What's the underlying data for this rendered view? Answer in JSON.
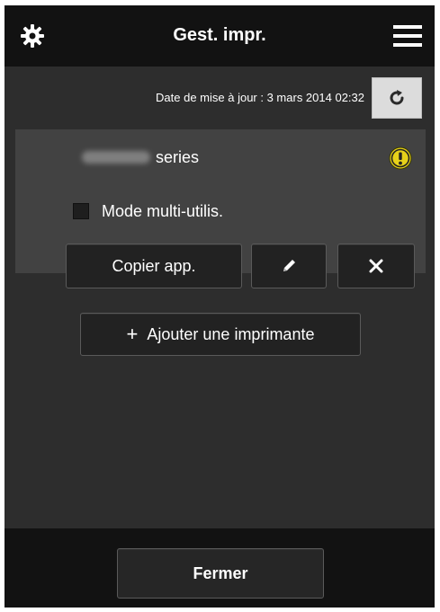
{
  "header": {
    "title": "Gest. impr.",
    "settings_icon": "gear-icon",
    "menu_icon": "hamburger-menu-icon"
  },
  "update": {
    "text": "Date de mise à jour : 3 mars 2014 02:32",
    "refresh_icon": "refresh-icon"
  },
  "printer": {
    "name_suffix": "series",
    "status_icon": "warning-icon",
    "multi_user_label": "Mode multi-utilis.",
    "multi_user_checked": false,
    "copy_label": "Copier app.",
    "edit_icon": "pencil-icon",
    "delete_icon": "close-icon"
  },
  "add_printer": {
    "label": "Ajouter une imprimante",
    "icon": "plus-icon"
  },
  "footer": {
    "close_label": "Fermer"
  },
  "colors": {
    "header_bg": "#121212",
    "screen_bg": "#2d2d2d",
    "panel_bg": "#424242",
    "warning": "#e6d11a",
    "refresh_bg": "#dcdcdc"
  }
}
